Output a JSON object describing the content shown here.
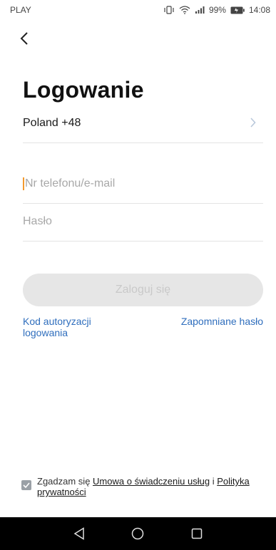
{
  "status_bar": {
    "carrier": "PLAY",
    "battery": "99%",
    "time": "14:08",
    "icons": [
      "vibrate-icon",
      "wifi-icon",
      "signal-icon",
      "battery-icon"
    ]
  },
  "header": {
    "back_icon": "chevron-left-icon",
    "title": "Logowanie"
  },
  "form": {
    "country": "Poland +48",
    "country_chevron_icon": "chevron-right-icon",
    "phone_placeholder": "Nr telefonu/e-mail",
    "password_placeholder": "Hasło",
    "login_button": "Zaloguj się"
  },
  "links": {
    "auth_code": "Kod autoryzacji logowania",
    "forgot_password": "Zapomniane hasło"
  },
  "consent": {
    "checked": true,
    "prefix": "Zgadzam się ",
    "terms_link": "Umowa o świadczeniu usług",
    "joiner": " i ",
    "privacy_link": "Polityka prywatności"
  },
  "nav": {
    "icons": [
      "back-triangle-icon",
      "home-circle-icon",
      "recents-square-icon"
    ]
  },
  "colors": {
    "link": "#2f6ebd",
    "button_disabled_bg": "#e6e6e6",
    "caret": "#f39a2e",
    "nav_bg": "#000000"
  }
}
